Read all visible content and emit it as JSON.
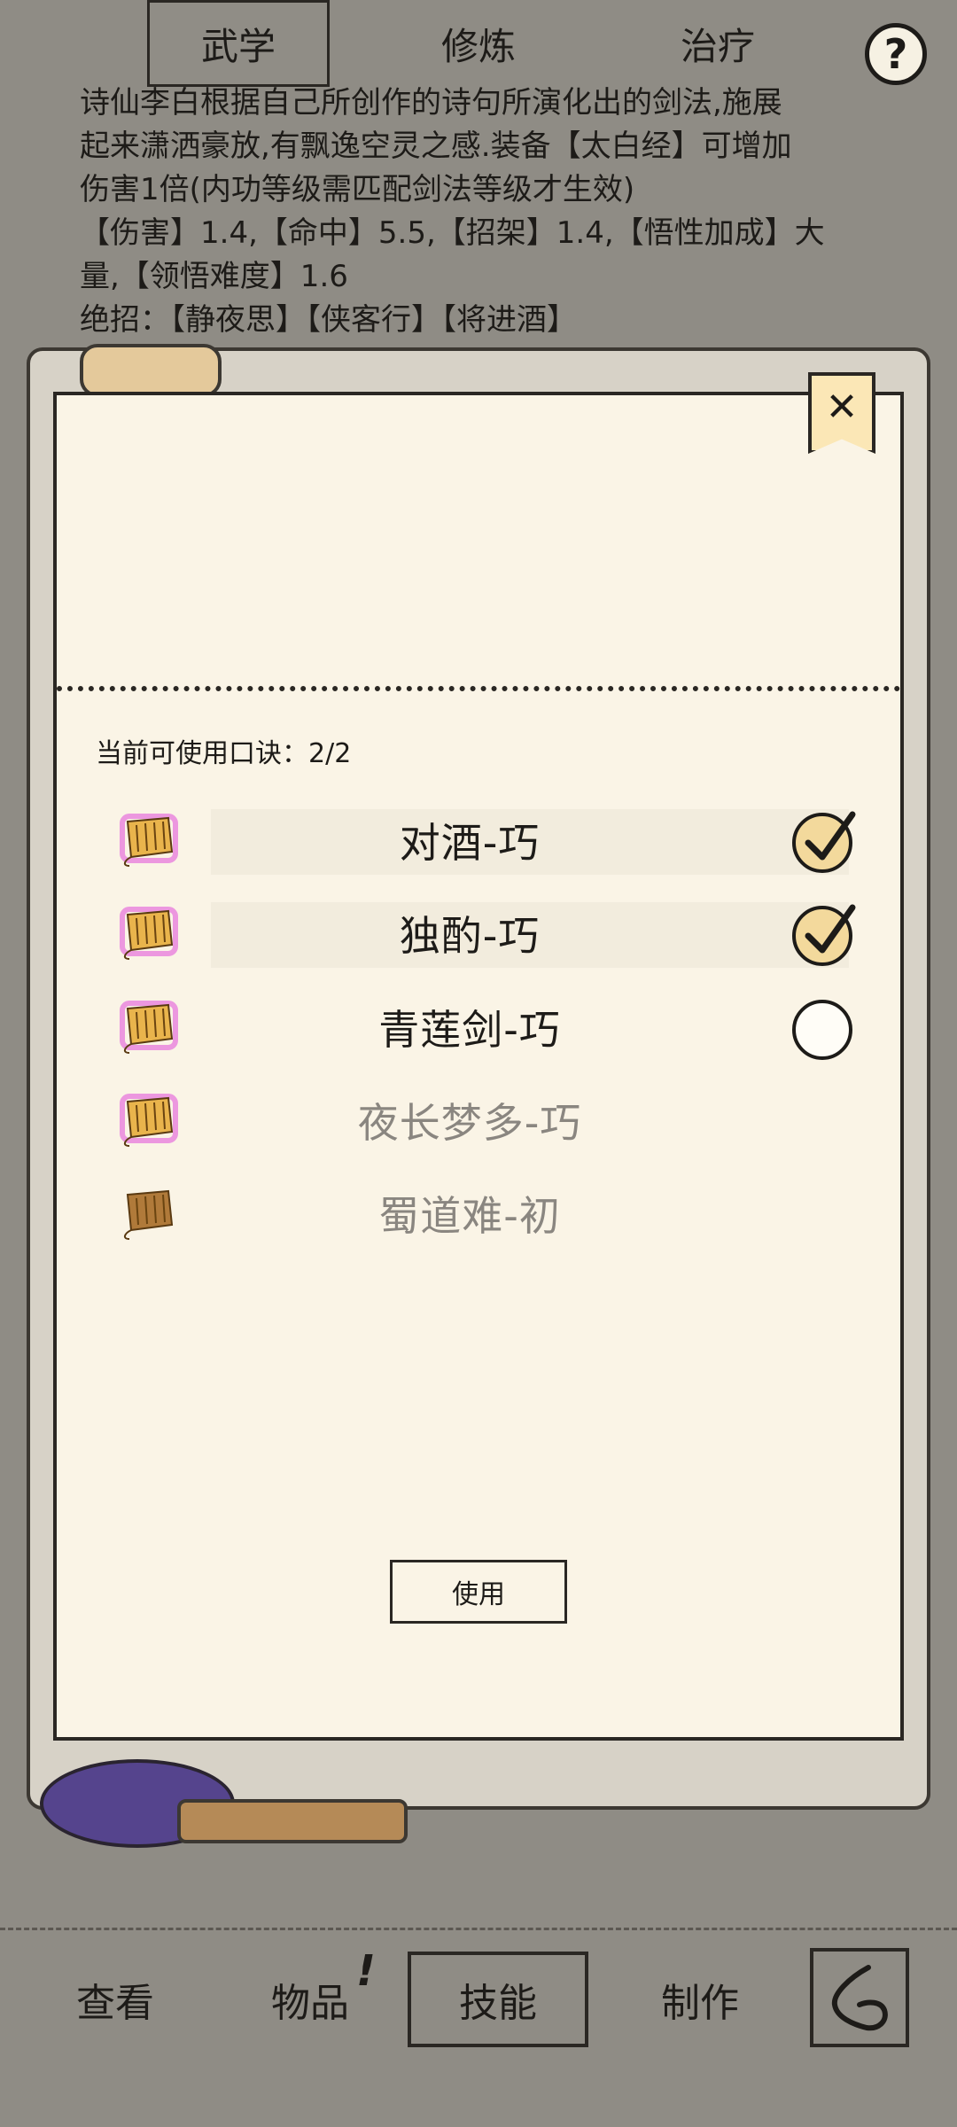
{
  "help": {
    "label": "?"
  },
  "description": {
    "lines": [
      "诗仙李白根据自己所创作的诗句所演化出的剑法,施展",
      "起来潇洒豪放,有飘逸空灵之感.装备【太白经】可增加",
      "伤害1倍(内功等级需匹配剑法等级才生效)",
      "【伤害】1.4,【命中】5.5,【招架】1.4,【悟性加成】大",
      "量,【领悟难度】1.6",
      "绝招：【静夜思】【侠客行】【将进酒】"
    ]
  },
  "panel": {
    "close_label": "✕",
    "count_text": "当前可使用口诀：2/2",
    "items": [
      {
        "name": "对酒-巧",
        "checked": true,
        "enabled": true,
        "icon": "golden-scroll-icon"
      },
      {
        "name": "独酌-巧",
        "checked": true,
        "enabled": true,
        "icon": "golden-scroll-icon"
      },
      {
        "name": "青莲剑-巧",
        "checked": false,
        "enabled": true,
        "icon": "golden-scroll-icon"
      },
      {
        "name": "夜长梦多-巧",
        "checked": false,
        "enabled": false,
        "icon": "golden-scroll-icon"
      },
      {
        "name": "蜀道难-初",
        "checked": false,
        "enabled": false,
        "icon": "bronze-scroll-icon"
      }
    ],
    "use_label": "使用"
  },
  "subtabs": [
    {
      "label": "武学",
      "active": true
    },
    {
      "label": "修炼",
      "active": false
    },
    {
      "label": "治疗",
      "active": false
    }
  ],
  "nav": {
    "view": "查看",
    "items": "物品",
    "items_badge": "!",
    "skills": "技能",
    "craft": "制作"
  },
  "colors": {
    "background": "#8f8c85",
    "panel": "#faf4e6",
    "check_on": "#f3d99c",
    "scroll_gold": "#e9b44c",
    "scroll_glow": "#e04ad8"
  }
}
